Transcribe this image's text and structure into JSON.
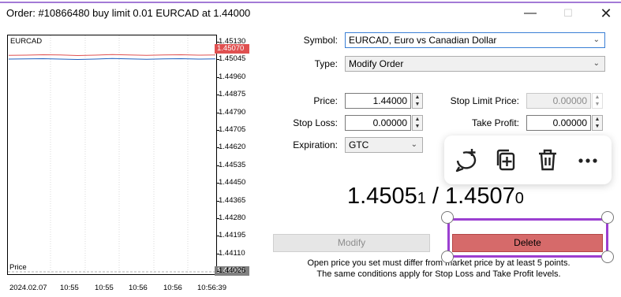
{
  "window": {
    "title": "Order: #10866480 buy limit 0.01 EURCAD at 1.44000",
    "minimize_icon": "minimize-icon",
    "maximize_icon": "maximize-icon",
    "close_icon": "close-icon"
  },
  "chart": {
    "symbol": "EURCAD",
    "bottom_label": "Price",
    "y_ticks": [
      "1.45130",
      "1.45045",
      "1.44960",
      "1.44875",
      "1.44790",
      "1.44705",
      "1.44620",
      "1.44535",
      "1.44450",
      "1.44365",
      "1.44280",
      "1.44195",
      "1.44110",
      "1.44025"
    ],
    "price_tag_high": "1.45070",
    "price_tag_low": "1.44000",
    "x_ticks": [
      "2024.02.07",
      "10:55",
      "10:55",
      "10:56",
      "10:56",
      "10:56:39"
    ],
    "colors": {
      "ask": "#e05050",
      "bid": "#2060c0",
      "tag_high": "#e05050",
      "tag_low": "#808080"
    }
  },
  "chart_data": {
    "type": "line",
    "title": "EURCAD",
    "xlabel": "",
    "ylabel": "Price",
    "ylim": [
      1.44025,
      1.4513
    ],
    "series": [
      {
        "name": "",
        "values": [
          1.45068,
          1.45069,
          1.45071,
          1.4507,
          1.45067,
          1.45069,
          1.45072,
          1.4507,
          1.45068,
          1.4507,
          1.45071,
          1.45069,
          1.4507
        ]
      },
      {
        "name": "",
        "values": [
          1.4505,
          1.45051,
          1.45052,
          1.4505,
          1.45048,
          1.4505,
          1.45053,
          1.45051,
          1.45049,
          1.45051,
          1.45052,
          1.4505,
          1.45051
        ]
      }
    ]
  },
  "form": {
    "symbol_label": "Symbol:",
    "symbol_value": "EURCAD, Euro vs Canadian Dollar",
    "type_label": "Type:",
    "type_value": "Modify Order",
    "price_label": "Price:",
    "price_value": "1.44000",
    "stop_limit_label": "Stop Limit Price:",
    "stop_limit_value": "0.00000",
    "stop_loss_label": "Stop Loss:",
    "stop_loss_value": "0.00000",
    "take_profit_label": "Take Profit:",
    "take_profit_value": "0.00000",
    "expiration_label": "Expiration:",
    "expiration_value": "GTC"
  },
  "quote": {
    "bid_main": "1.4505",
    "bid_small": "1",
    "sep": " / ",
    "ask_main": "1.4507",
    "ask_small": "0"
  },
  "buttons": {
    "modify": "Modify",
    "delete": "Delete"
  },
  "notes": {
    "line1": "Open price you set must differ from market price by at least 5 points.",
    "line2": "The same conditions apply for Stop Loss and Take Profit levels."
  },
  "toolbar": {
    "icons": [
      "comment-add-icon",
      "copy-icon",
      "delete-icon",
      "more-icon"
    ]
  }
}
